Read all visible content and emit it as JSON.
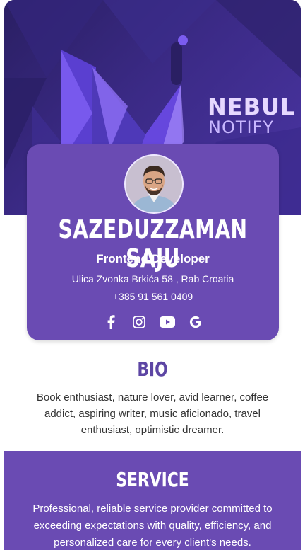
{
  "banner": {
    "brand_line1": "NEBUL",
    "brand_line2": "NOTIFY"
  },
  "profile": {
    "name": "SAZEDUZZAMAN SAJU",
    "role": "Frontend Developer",
    "address": "Ulica Zvonka Brkića 58 , Rab Croatia",
    "phone": "+385 91 561 0409",
    "socials": [
      {
        "icon": "facebook-icon"
      },
      {
        "icon": "instagram-icon"
      },
      {
        "icon": "youtube-icon"
      },
      {
        "icon": "google-icon"
      }
    ]
  },
  "bio": {
    "title": "BIO",
    "text": "Book enthusiast, nature lover, avid learner, coffee addict, aspiring writer, music aficionado, travel enthusiast, optimistic dreamer."
  },
  "service": {
    "title": "SERVICE",
    "text": "Professional, reliable service provider committed to exceeding expectations with quality, efficiency, and personalized care for every client's needs."
  },
  "colors": {
    "accent": "#6a4bb3",
    "heading": "#5d46a4",
    "banner_dark": "#2a1f63"
  }
}
